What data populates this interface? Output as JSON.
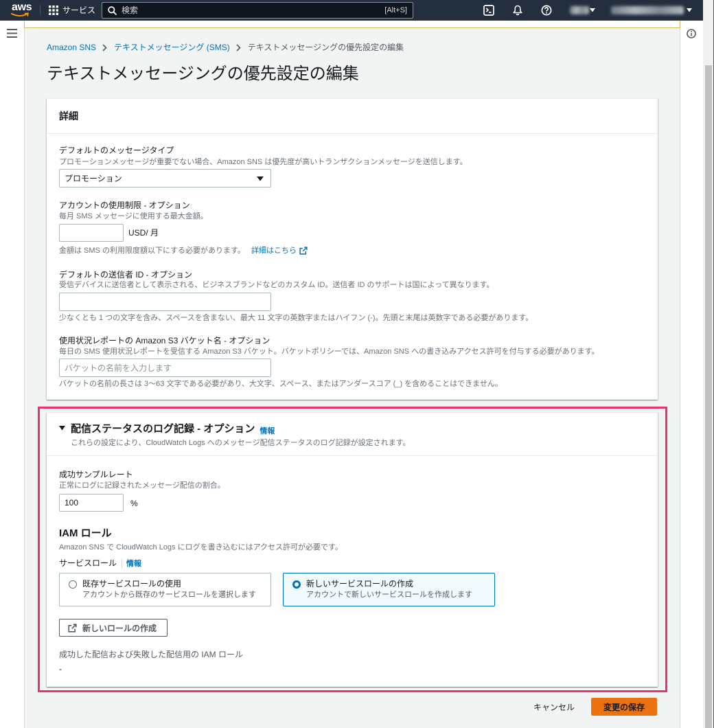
{
  "nav": {
    "logo": "aws",
    "services_label": "サービス",
    "search_placeholder": "検索",
    "search_shortcut": "[Alt+S]"
  },
  "breadcrumb": {
    "items": [
      {
        "label": "Amazon SNS"
      },
      {
        "label": "テキストメッセージング (SMS)"
      },
      {
        "label": "テキストメッセージングの優先設定の編集"
      }
    ]
  },
  "page_title": "テキストメッセージングの優先設定の編集",
  "details": {
    "title": "詳細",
    "message_type": {
      "label": "デフォルトのメッセージタイプ",
      "description": "プロモーションメッセージが重要でない場合、Amazon SNS は優先度が高いトランザクションメッセージを送信します。",
      "value": "プロモーション"
    },
    "spend_limit": {
      "label": "アカウントの使用制限 - オプション",
      "description": "毎月 SMS メッセージに使用する最大金額。",
      "value": "",
      "unit": "USD/ 月",
      "hint": "金額は SMS の利用限度額以下にする必要があります。",
      "link": "詳細はこちら"
    },
    "sender_id": {
      "label": "デフォルトの送信者 ID - オプション",
      "description": "受信デバイスに送信者として表示される、ビジネスブランドなどのカスタム ID。送信者 ID のサポートは国によって異なります。",
      "value": "",
      "hint": "少なくとも 1 つの文字を含み、スペースを含まない、最大 11 文字の英数字またはハイフン (-)。先頭と末尾は英数字である必要があります。"
    },
    "s3_bucket": {
      "label": "使用状況レポートの Amazon S3 バケット名 - オプション",
      "description": "毎日の SMS 使用状況レポートを受信する Amazon S3 バケット。バケットポリシーでは、Amazon SNS への書き込みアクセス許可を付与する必要があります。",
      "placeholder": "バケットの名前を入力します",
      "hint": "バケットの名前の長さは 3～63 文字である必要があり、大文字、スペース、またはアンダースコア (_) を含めることはできません。"
    }
  },
  "logging": {
    "title": "配信ステータスのログ記録 - オプション",
    "info": "情報",
    "description": "これらの設定により、CloudWatch Logs へのメッセージ配信ステータスのログ記録が設定されます。",
    "sample_rate": {
      "label": "成功サンプルレート",
      "description": "正常にログに記録されたメッセージ配信の割合。",
      "value": "100",
      "unit": "%"
    },
    "iam": {
      "title": "IAM ロール",
      "description": "Amazon SNS で CloudWatch Logs にログを書き込むにはアクセス許可が必要です。"
    },
    "service_role": {
      "label": "サービスロール",
      "info": "情報",
      "options": [
        {
          "title": "既存サービスロールの使用",
          "description": "アカウントから既存のサービスロールを選択します",
          "selected": false
        },
        {
          "title": "新しいサービスロールの作成",
          "description": "アカウントで新しいサービスロールを作成します",
          "selected": true
        }
      ]
    },
    "create_role_button": "新しいロールの作成",
    "iam_roles_label": "成功した配信および失敗した配信用の IAM ロール",
    "iam_roles_value": "-"
  },
  "footer": {
    "cancel": "キャンセル",
    "save": "変更の保存"
  },
  "colors": {
    "nav_background": "#232f3e",
    "link": "#0073bb",
    "highlight_border": "#e8336d",
    "primary_button": "#ec7211",
    "page_background": "#f2f3f3",
    "selected_tile_background": "#f1faff"
  },
  "icons": {
    "services": "grid-icon",
    "search": "search-icon",
    "cloudshell": "terminal-icon",
    "notifications": "bell-icon",
    "support": "help-icon",
    "menu": "hamburger-icon",
    "tools": "info-icon",
    "external_link": "external-link-icon",
    "select": "caret-down-icon",
    "expand": "caret-down-icon",
    "breadcrumb_separator": "chevron-right-icon"
  }
}
